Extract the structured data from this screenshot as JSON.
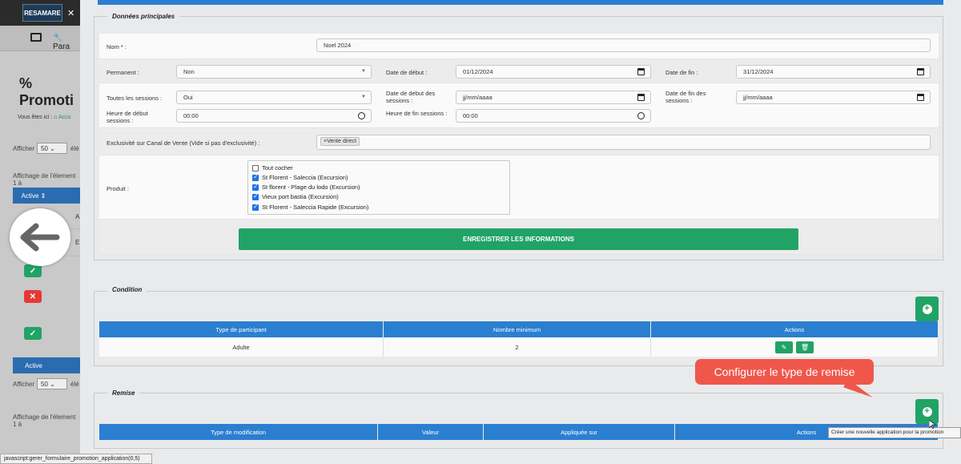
{
  "app": {
    "logo": "RESAMARE",
    "nav_label": "Para",
    "page_title": "Promoti",
    "breadcrumb_prefix": "Vous êtes ici :",
    "breadcrumb_link": "Accu"
  },
  "bg_list": {
    "show_label": "Afficher",
    "show_value": "50",
    "show_suffix": "élé",
    "display_info": "Affichage de l'élement 1 à",
    "col_active": "Active",
    "row_fragments": [
      "A",
      "E"
    ]
  },
  "donnees": {
    "legend": "Données principales",
    "nom_label": "Nom * :",
    "nom_value": "Noel 2024",
    "permanent_label": "Permanent :",
    "permanent_value": "Non",
    "date_debut_label": "Date de début :",
    "date_debut_value": "01/12/2024",
    "date_fin_label": "Date de fin :",
    "date_fin_value": "31/12/2024",
    "toutes_sessions_label": "Toutes les sessions :",
    "toutes_sessions_value": "Oui",
    "date_debut_sessions_label": "Date de debut des sessions :",
    "date_debut_sessions_value": "jj/mm/aaaa",
    "date_fin_sessions_label": "Date de fin des sessions :",
    "date_fin_sessions_value": "jj/mm/aaaa",
    "heure_debut_label": "Heure de début sessions :",
    "heure_debut_value": "00:00",
    "heure_fin_label": "Heure de fin sessions :",
    "heure_fin_value": "00:00",
    "exclusivite_label": "Exclusivité sur Canal de Vente (Vide si pas d'exclusivité) :",
    "exclusivite_tag": "×Vente direct",
    "produit_label": "Produit :",
    "produits": [
      {
        "label": "Tout cocher",
        "checked": false
      },
      {
        "label": "St Florent - Saleccia (Excursion)",
        "checked": true
      },
      {
        "label": "St florent - Plage du lodo (Excursion)",
        "checked": true
      },
      {
        "label": "Vieux port bastia (Excursion)",
        "checked": true
      },
      {
        "label": "St Florent - Saleccia Rapide (Excursion)",
        "checked": true
      }
    ],
    "save_label": "ENREGISTRER LES INFORMATIONS"
  },
  "condition": {
    "legend": "Condition",
    "headers": [
      "Type de participant",
      "Nombre minimum",
      "Actions"
    ],
    "rows": [
      {
        "type": "Adulte",
        "min": "2"
      }
    ]
  },
  "remise": {
    "legend": "Remise",
    "headers": [
      "Type de modification",
      "Valeur",
      "Appliquée sur",
      "Actions"
    ]
  },
  "callout": "Configurer le type de remise",
  "hover_tooltip": "Créer une nouvelle application pour la promotion",
  "status_url": "javascript:gerer_formulaire_promotion_application(0,5)",
  "colors": {
    "primary_blue": "#2b7fd0",
    "green": "#21a366",
    "danger": "#e53935",
    "callout": "#f0574b"
  }
}
